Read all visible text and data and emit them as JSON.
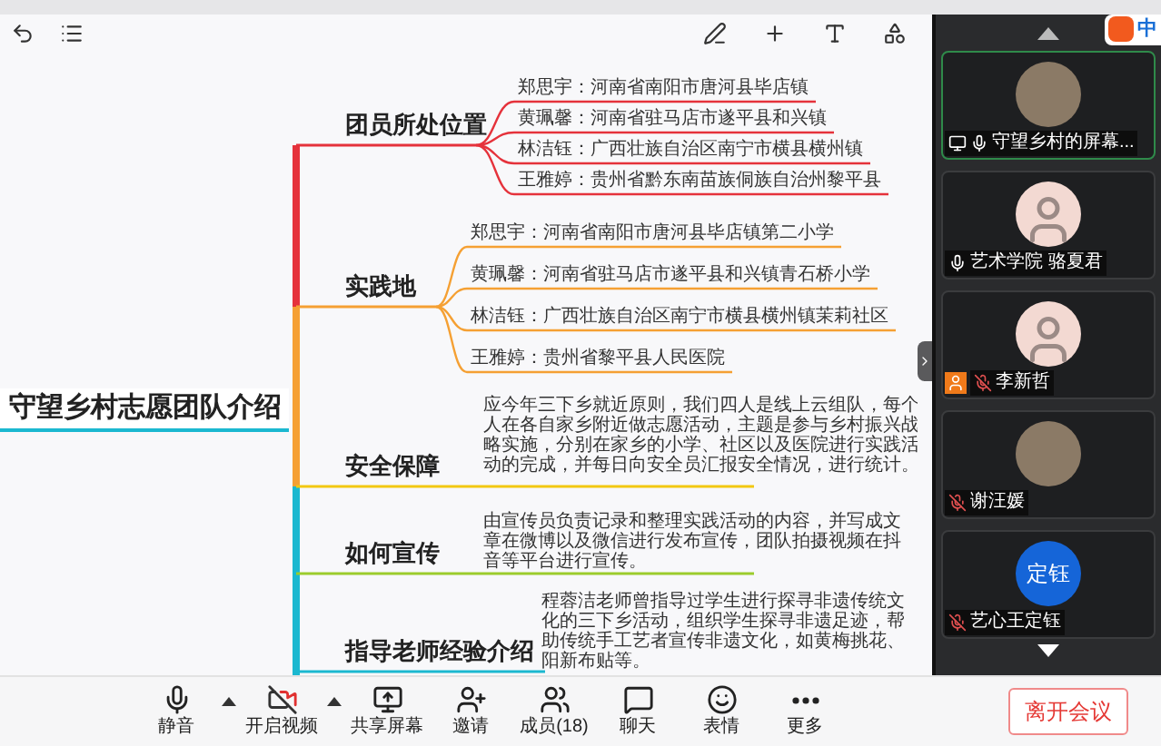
{
  "mindmap": {
    "root": "守望乡村志愿团队介绍",
    "topics": [
      {
        "title": "团员所处位置",
        "color": "#e5323b",
        "children": [
          {
            "text": "郑思宇：河南省南阳市唐河县毕店镇"
          },
          {
            "text": "黄珮馨：河南省驻马店市遂平县和兴镇"
          },
          {
            "text": "林洁钰：广西壮族自治区南宁市横县横州镇"
          },
          {
            "text": "王雅婷：贵州省黔东南苗族侗族自治州黎平县"
          }
        ]
      },
      {
        "title": "实践地",
        "color": "#f5a033",
        "children": [
          {
            "text": "郑思宇：河南省南阳市唐河县毕店镇第二小学"
          },
          {
            "text": "黄珮馨：河南省驻马店市遂平县和兴镇青石桥小学"
          },
          {
            "text": "林洁钰：广西壮族自治区南宁市横县横州镇茉莉社区"
          },
          {
            "text": "王雅婷：贵州省黎平县人民医院"
          }
        ]
      },
      {
        "title": "安全保障",
        "color": "#f2c811",
        "note": "应今年三下乡就近原则，我们四人是线上云组队，每个人在各自家乡附近做志愿活动，主题是参与乡村振兴战略实施，分别在家乡的小学、社区以及医院进行实践活动的完成，并每日向安全员汇报安全情况，进行统计。"
      },
      {
        "title": "如何宣传",
        "color": "#9ccc2c",
        "note": "由宣传员负责记录和整理实践活动的内容，并写成文章在微博以及微信进行发布宣传，团队拍摄视频在抖音等平台进行宣传。"
      },
      {
        "title": "指导老师经验介绍",
        "color": "#1bb8d0",
        "note": "程蓉洁老师曾指导过学生进行探寻非遗传统文化的三下乡活动，组织学生探寻非遗足迹，帮助传统手工艺者宣传非遗文化，如黄梅挑花、阳新布贴等。"
      }
    ]
  },
  "ime": {
    "label": "中"
  },
  "participants": [
    {
      "name": "守望乡村的屏幕...",
      "kind": "photo",
      "selected": true,
      "sharing": true,
      "host": false,
      "muted": false
    },
    {
      "name": "艺术学院 骆夏君",
      "kind": "cartoon",
      "selected": false,
      "sharing": false,
      "host": false,
      "muted": false
    },
    {
      "name": "李新哲",
      "kind": "cartoon",
      "selected": false,
      "sharing": false,
      "host": true,
      "muted": true
    },
    {
      "name": "谢汪媛",
      "kind": "photo",
      "selected": false,
      "sharing": false,
      "host": false,
      "muted": true
    },
    {
      "name": "艺心王定钰",
      "kind": "text",
      "avatar_text": "定钰",
      "selected": false,
      "sharing": false,
      "host": false,
      "muted": true
    }
  ],
  "bottom_bar": {
    "buttons": [
      {
        "label": "静音",
        "kind": "mic",
        "has_menu": true
      },
      {
        "label": "开启视频",
        "kind": "video_off",
        "has_menu": true
      },
      {
        "label": "共享屏幕",
        "kind": "share",
        "has_menu": false
      },
      {
        "label": "邀请",
        "kind": "invite",
        "has_menu": false
      },
      {
        "label": "成员(18)",
        "kind": "members",
        "has_menu": false
      },
      {
        "label": "聊天",
        "kind": "chat",
        "has_menu": false
      },
      {
        "label": "表情",
        "kind": "emoji",
        "has_menu": false
      },
      {
        "label": "更多",
        "kind": "more",
        "has_menu": false
      }
    ]
  },
  "leave_button": "离开会议"
}
